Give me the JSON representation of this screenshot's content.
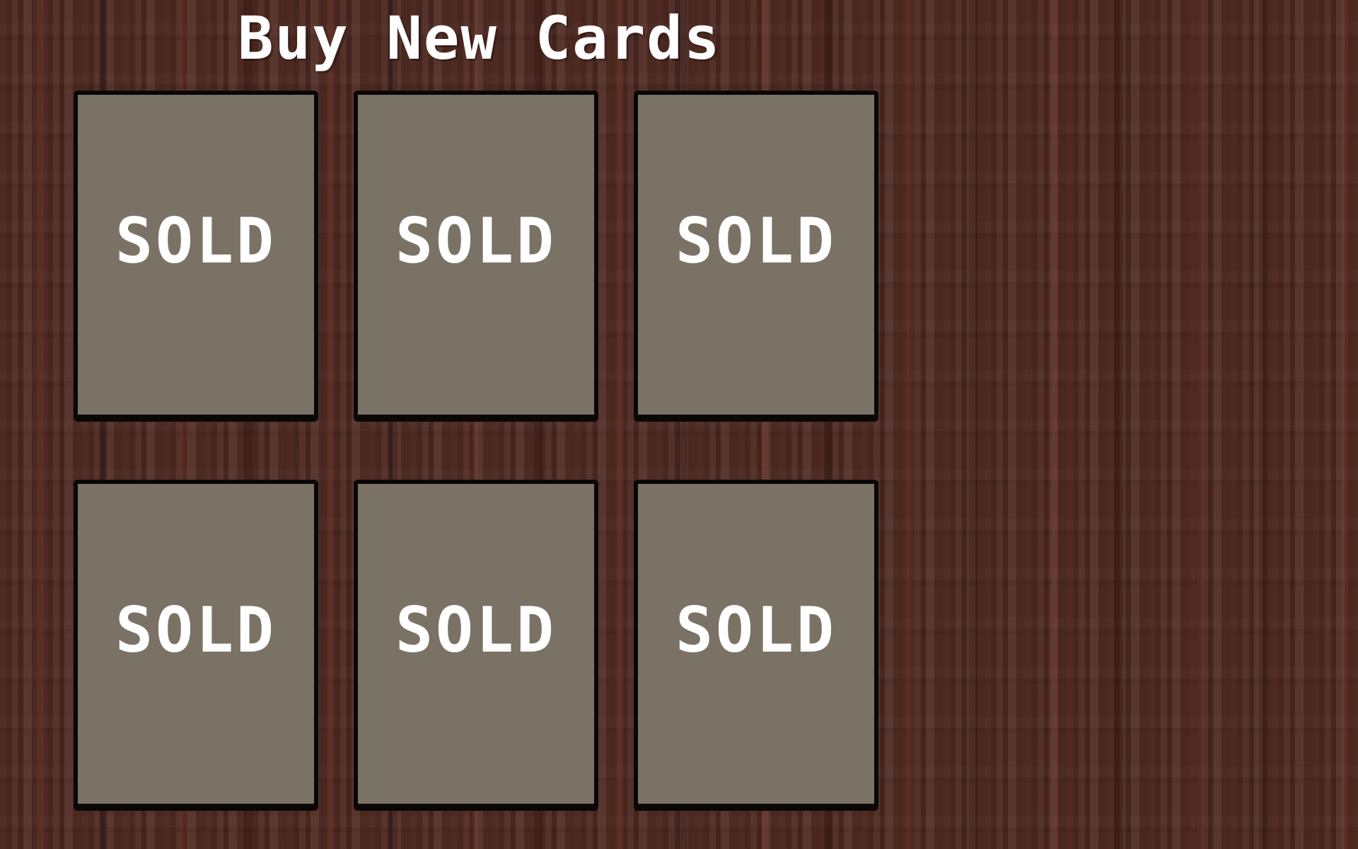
{
  "shop": {
    "title": "Buy New Cards",
    "cards": [
      {
        "label": "SOLD"
      },
      {
        "label": "SOLD"
      },
      {
        "label": "SOLD"
      },
      {
        "label": "SOLD"
      },
      {
        "label": "SOLD"
      },
      {
        "label": "SOLD"
      }
    ]
  },
  "colors": {
    "background_wood": "#4f2a22",
    "card_fill": "#7a7265",
    "card_border": "#0a0807",
    "text": "#ffffff"
  }
}
